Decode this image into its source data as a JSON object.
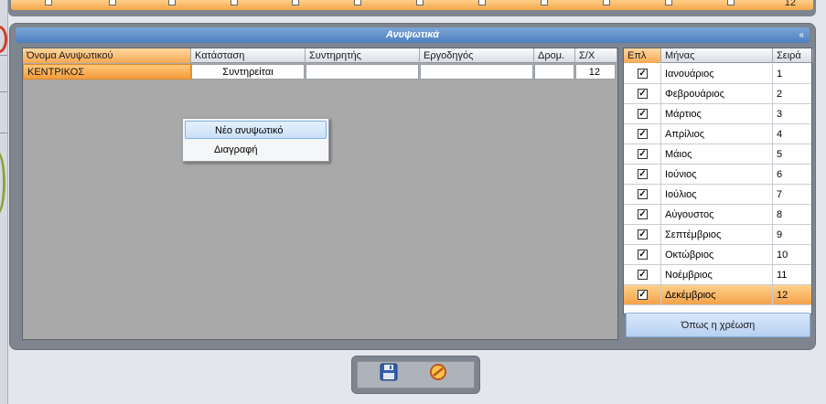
{
  "top_strip": {
    "visible_number": "12"
  },
  "panel": {
    "title": "Ανυψωτικά",
    "collapse_glyph": "«"
  },
  "heaters": {
    "columns": [
      "Όνομα Ανυψωτικού",
      "Κατάσταση",
      "Συντηρητής",
      "Εργοδηγός",
      "Δρομ.",
      "Σ/Χ"
    ],
    "rows": [
      {
        "name": "ΚΕΝΤΡΙΚΟΣ",
        "status": "Συντηρείται",
        "maintainer": "",
        "foreman": "",
        "route": "",
        "sx": "12"
      }
    ]
  },
  "context_menu": {
    "items": [
      "Νέο ανυψωτικό",
      "Διαγραφή"
    ]
  },
  "months": {
    "columns": [
      "Επλ",
      "Μήνας",
      "Σειρά"
    ],
    "check_glyph": "✓",
    "rows": [
      {
        "month": "Ιανουάριος",
        "order": "1"
      },
      {
        "month": "Φεβρουάριος",
        "order": "2"
      },
      {
        "month": "Μάρτιος",
        "order": "3"
      },
      {
        "month": "Απρίλιος",
        "order": "4"
      },
      {
        "month": "Μάιος",
        "order": "5"
      },
      {
        "month": "Ιούνιος",
        "order": "6"
      },
      {
        "month": "Ιούλιος",
        "order": "7"
      },
      {
        "month": "Αύγουστος",
        "order": "8"
      },
      {
        "month": "Σεπτέμβριος",
        "order": "9"
      },
      {
        "month": "Οκτώβριος",
        "order": "10"
      },
      {
        "month": "Νοέμβριος",
        "order": "11"
      },
      {
        "month": "Δεκέμβριος",
        "order": "12"
      }
    ],
    "as_charge_button": "Όπως η χρέωση"
  },
  "icons": {
    "save": "floppy-disk-icon",
    "cancel": "cancel-icon"
  },
  "colors": {
    "panel": "#7f858e",
    "title_bar": "#4d7fbf",
    "selected_row": "#f4a24a",
    "grid_empty": "#a9a9a9"
  }
}
